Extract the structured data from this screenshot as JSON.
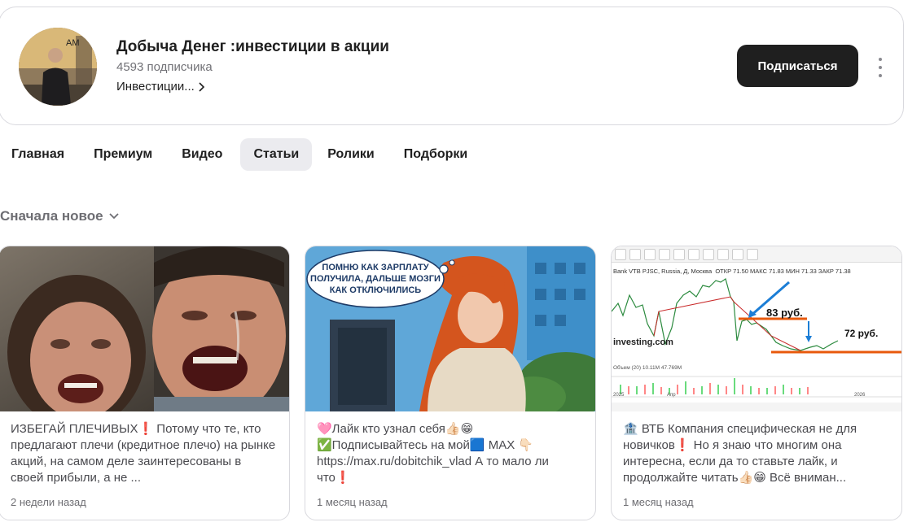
{
  "channel": {
    "title": "Добыча Денег :инвестиции в акции",
    "subscribers": "4593 подписчика",
    "category": "Инвестиции...",
    "subscribe_label": "Подписаться",
    "avatar_text": "AM"
  },
  "tabs": [
    {
      "label": "Главная",
      "active": false
    },
    {
      "label": "Премиум",
      "active": false
    },
    {
      "label": "Видео",
      "active": false
    },
    {
      "label": "Статьи",
      "active": true
    },
    {
      "label": "Ролики",
      "active": false
    },
    {
      "label": "Подборки",
      "active": false
    }
  ],
  "sort": {
    "label": "Сначала новое"
  },
  "articles": [
    {
      "text": "ИЗБЕГАЙ ПЛЕЧИВЫХ❗️ Потому что те, кто предлагают плечи (кредитное плечо) на рынке акций, на самом деле заинтересованы в своей прибыли, а не ...",
      "date": "2 недели назад"
    },
    {
      "text": "🩷Лайк кто узнал себя👍🏻😁 ✅Подписывайтесь на мой🟦 MAX 👇🏻 https://max.ru/dobitchik_vlad А то мало ли что❗️",
      "date": "1 месяц назад",
      "bubble_lines": [
        "ПОМНЮ КАК ЗАРПЛАТУ",
        "ПОЛУЧИЛА, ДАЛЬШЕ МОЗГИ",
        "КАК ОТКЛЮЧИЛИСЬ"
      ]
    },
    {
      "text": "🏦 ВТБ Компания специфическая не для новичков❗️ Но я знаю что многим она интересна, если да то ставьте лайк, и продолжайте читать👍🏻😁 Всё вниман...",
      "date": "1 месяц назад",
      "chart": {
        "title": "Bank VTB PJSC, Russia, Д, Москва",
        "ohlc": "ОТКР 71.50  МАКС 71.83  МИН 71.33  ЗАКР 71.38",
        "label_high": "83 руб.",
        "label_low": "72 руб.",
        "watermark": "investing.com",
        "volume": "Объем (20)  10.11M  47.769M",
        "year_left": "2025",
        "year_right": "2026",
        "year_mid": "Апр"
      }
    }
  ]
}
